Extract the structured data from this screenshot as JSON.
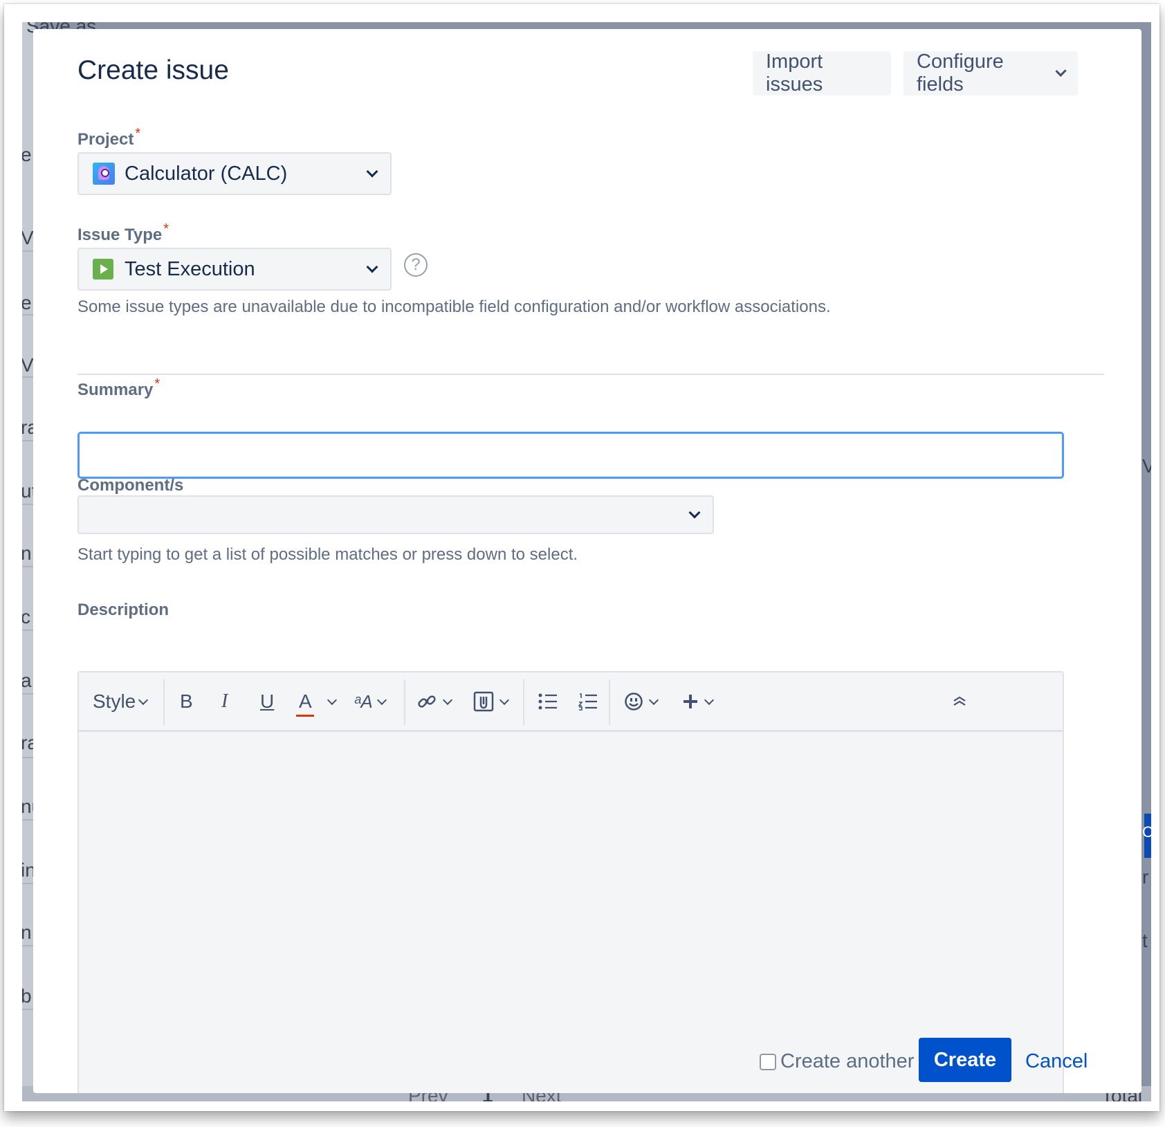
{
  "background": {
    "top_fragment": "Save as",
    "left_fragments": [
      "e:",
      "Vie",
      "e",
      "Ve",
      "ra",
      "ut",
      "n",
      "c",
      "a",
      "ra",
      "nu",
      "in",
      "n",
      "b"
    ],
    "right_fragments": [
      "V",
      "C",
      "r",
      "t"
    ],
    "pagination": {
      "prev": "Prev",
      "page": "1",
      "next": "Next"
    },
    "total": "Total"
  },
  "dialog": {
    "title": "Create issue",
    "import_button": "Import issues",
    "configure_button": "Configure fields"
  },
  "project": {
    "label": "Project",
    "required_mark": "*",
    "value": "Calculator (CALC)"
  },
  "issue_type": {
    "label": "Issue Type",
    "required_mark": "*",
    "value": "Test Execution",
    "help": "?",
    "hint": "Some issue types are unavailable due to incompatible field configuration and/or workflow associations."
  },
  "summary": {
    "label": "Summary",
    "required_mark": "*",
    "value": ""
  },
  "components": {
    "label": "Component/s",
    "value": "",
    "hint": "Start typing to get a list of possible matches or press down to select."
  },
  "description": {
    "label": "Description",
    "toolbar": {
      "style": "Style",
      "bold": "B",
      "italic": "I",
      "underline": "U",
      "text_color": "A",
      "more_format": "ᵃA"
    },
    "text_color_bar": "#de350b"
  },
  "footer": {
    "create_another": "Create another",
    "create": "Create",
    "cancel": "Cancel"
  },
  "colors": {
    "primary": "#0052cc",
    "focus": "#4c9aff",
    "required": "#de350b"
  }
}
